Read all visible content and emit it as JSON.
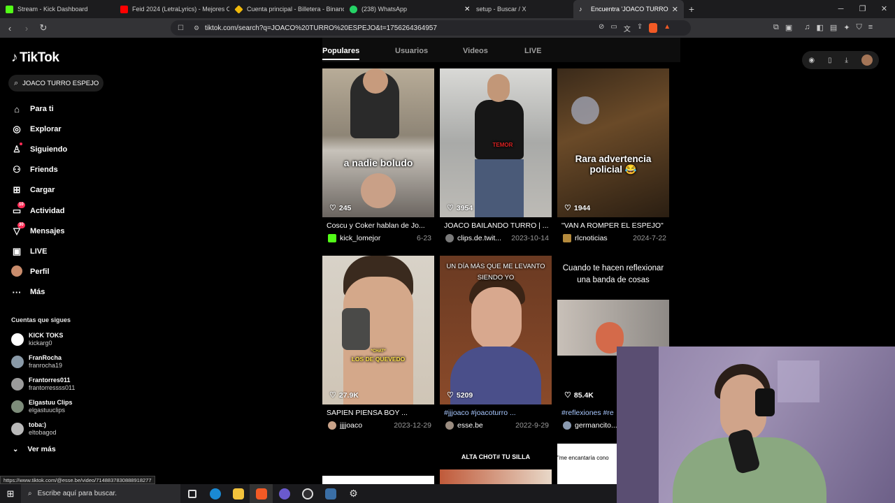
{
  "browser": {
    "tabs": [
      {
        "title": "Stream - Kick Dashboard",
        "color": "#53fc18"
      },
      {
        "title": "Feid 2024 (LetraLyrics) - Mejores Can",
        "color": "#ff0000"
      },
      {
        "title": "Cuenta principal - Billetera - Binance",
        "color": "#f0b90b"
      },
      {
        "title": "(238) WhatsApp",
        "color": "#25d366"
      },
      {
        "title": "setup - Buscar / X",
        "color": "#ffffff"
      },
      {
        "title": "Encuentra 'JOACO TURRO ESPEJO'",
        "color": "#000000"
      }
    ],
    "url": "tiktok.com/search?q=JOACO%20TURRO%20ESPEJO&t=1756264364957"
  },
  "sidebar": {
    "logo": "TikTok",
    "search_value": "JOACO TURRO ESPEJO",
    "nav": [
      {
        "label": "Para ti",
        "icon": "home-icon"
      },
      {
        "label": "Explorar",
        "icon": "compass-icon"
      },
      {
        "label": "Siguiendo",
        "icon": "following-icon"
      },
      {
        "label": "Friends",
        "icon": "friends-icon"
      },
      {
        "label": "Cargar",
        "icon": "upload-icon"
      },
      {
        "label": "Actividad",
        "icon": "activity-icon",
        "badge": "10"
      },
      {
        "label": "Mensajes",
        "icon": "messages-icon",
        "badge": "30"
      },
      {
        "label": "LIVE",
        "icon": "live-icon"
      },
      {
        "label": "Perfil",
        "icon": "profile-avatar"
      },
      {
        "label": "Más",
        "icon": "more-icon"
      }
    ],
    "following_header": "Cuentas que sigues",
    "following": [
      {
        "name": "KICK TOKS",
        "handle": "kickarg0"
      },
      {
        "name": "FranRocha",
        "handle": "franrocha19"
      },
      {
        "name": "Frantorres011",
        "handle": "frantorressss011"
      },
      {
        "name": "Elgastuu Clips",
        "handle": "elgastuuclips"
      },
      {
        "name": "toba:)",
        "handle": "eltobagod"
      }
    ],
    "see_more": "Ver más"
  },
  "results_tabs": [
    "Populares",
    "Usuarios",
    "Videos",
    "LIVE"
  ],
  "videos": [
    {
      "likes": "245",
      "caption": "Coscu y Coker hablan de Jo...",
      "user": "kick_lomejor",
      "date": "6-23",
      "overlay": "a nadie boludo"
    },
    {
      "likes": "3954",
      "caption": "JOACO BAILANDO TURRO | ...",
      "user": "clips.de.twit...",
      "date": "2023-10-14",
      "overlay": "TEMOR"
    },
    {
      "likes": "1944",
      "caption": "\"VAN A ROMPER EL ESPEJO\"",
      "user": "rlcnoticias",
      "date": "2024-7-22",
      "overlay": "Rara advertencia policial 😂"
    },
    {
      "likes": "27.9K",
      "caption": "SAPIEN PIENSA BOY ...",
      "user": "jjjjoaco",
      "date": "2023-12-29",
      "overlay": "LOS DE QUEVEDO",
      "overlay2": "*CHAT*"
    },
    {
      "likes": "5209",
      "caption": "#jjjoaco #joacoturro ...",
      "user": "esse.be",
      "date": "2022-9-29",
      "overlay": "UN DÍA MÁS QUE ME LEVANTO SIENDO YO"
    },
    {
      "likes": "85.4K",
      "caption": "#reflexiones #re",
      "user": "germancito...",
      "date": "",
      "overlay": "Cuando te hacen reflexionar una banda de cosas"
    }
  ],
  "row3": {
    "chot": "ALTA CHOT# TU SILLA",
    "encantaria": "\"me encantaría cono"
  },
  "status_url": "https://www.tiktok.com/@esse.be/video/7148837830888918277",
  "taskbar": {
    "search_placeholder": "Escribe aquí para buscar."
  }
}
